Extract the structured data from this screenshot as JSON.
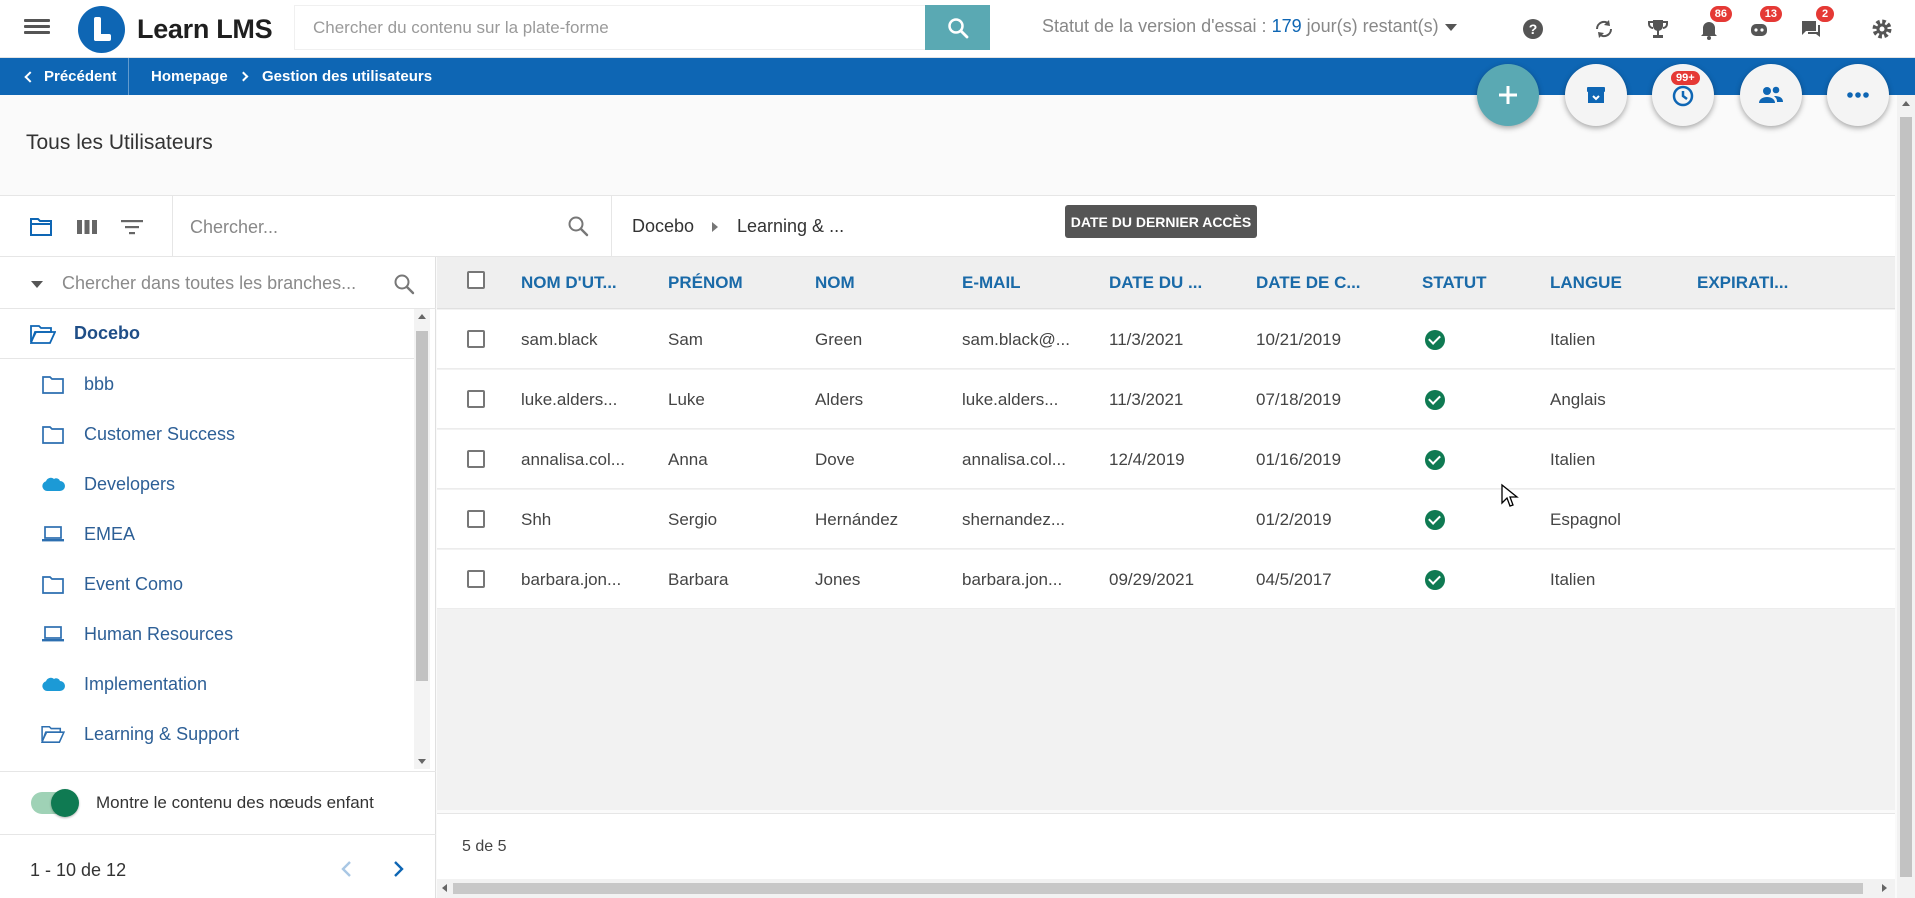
{
  "app": {
    "logo_text": "Learn LMS"
  },
  "top_search": {
    "placeholder": "Chercher du contenu sur la plate-forme"
  },
  "trial": {
    "prefix": "Statut de la version d'essai : ",
    "days": "179",
    "suffix": " jour(s) restant(s)"
  },
  "notifications": {
    "bell_count": "86",
    "support_count": "13",
    "messages_count": "2"
  },
  "breadcrumb": {
    "back_label": "Précédent",
    "home": "Homepage",
    "current": "Gestion des utilisateurs"
  },
  "fab": {
    "history_badge": "99+"
  },
  "page": {
    "title": "Tous les Utilisateurs"
  },
  "toolbar": {
    "search_placeholder": "Chercher...",
    "path": [
      "Docebo",
      "Learning & ..."
    ]
  },
  "tooltip": {
    "text": "DATE DU DERNIER ACCÈS"
  },
  "branches": {
    "search_placeholder": "Chercher dans toutes les branches...",
    "root": "Docebo",
    "items": [
      {
        "label": "bbb",
        "icon": "folder-icon"
      },
      {
        "label": "Customer Success",
        "icon": "folder-icon"
      },
      {
        "label": "Developers",
        "icon": "salesforce-cloud-icon"
      },
      {
        "label": "EMEA",
        "icon": "laptop-icon"
      },
      {
        "label": "Event Como",
        "icon": "folder-icon"
      },
      {
        "label": "Human Resources",
        "icon": "laptop-icon"
      },
      {
        "label": "Implementation",
        "icon": "salesforce-cloud-icon"
      },
      {
        "label": "Learning & Support",
        "icon": "folder-open-icon"
      }
    ],
    "toggle_label": "Montre le contenu des nœuds enfant",
    "toggle_on": true,
    "pager": "1 - 10 de 12"
  },
  "table": {
    "columns": [
      "NOM D'UT...",
      "PRÉNOM",
      "NOM",
      "E-MAIL",
      "DATE DU ...",
      "DATE DE C...",
      "STATUT",
      "LANGUE",
      "EXPIRATI..."
    ],
    "rows": [
      {
        "username": "sam.black",
        "first": "Sam",
        "last": "Green",
        "email": "sam.black@...",
        "last_access": "11/3/2021",
        "created": "10/21/2019",
        "status": "active",
        "language": "Italien",
        "expiration": ""
      },
      {
        "username": "luke.alders...",
        "first": "Luke",
        "last": "Alders",
        "email": "luke.alders...",
        "last_access": "11/3/2021",
        "created": "07/18/2019",
        "status": "active",
        "language": "Anglais",
        "expiration": ""
      },
      {
        "username": "annalisa.col...",
        "first": "Anna",
        "last": "Dove",
        "email": "annalisa.col...",
        "last_access": "12/4/2019",
        "created": "01/16/2019",
        "status": "active",
        "language": "Italien",
        "expiration": ""
      },
      {
        "username": "Shh",
        "first": "Sergio",
        "last": "Hernández",
        "email": "shernandez...",
        "last_access": "",
        "created": "01/2/2019",
        "status": "active",
        "language": "Espagnol",
        "expiration": ""
      },
      {
        "username": "barbara.jon...",
        "first": "Barbara",
        "last": "Jones",
        "email": "barbara.jon...",
        "last_access": "09/29/2021",
        "created": "04/5/2017",
        "status": "active",
        "language": "Italien",
        "expiration": ""
      }
    ],
    "count_label": "5 de 5"
  },
  "colors": {
    "brand_blue": "#0e66b4",
    "teal": "#5aa9b3",
    "status_green": "#0f7a52",
    "badge_red": "#e53935"
  }
}
